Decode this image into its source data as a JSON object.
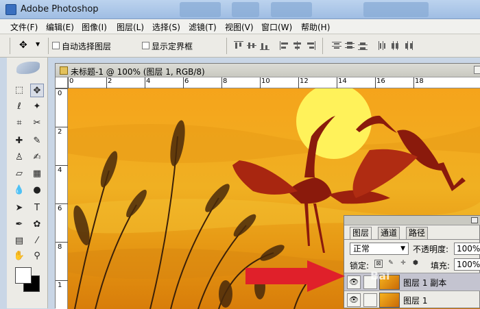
{
  "app": {
    "title": "Adobe Photoshop"
  },
  "menu": [
    "文件(F)",
    "编辑(E)",
    "图像(I)",
    "图层(L)",
    "选择(S)",
    "滤镜(T)",
    "视图(V)",
    "窗口(W)",
    "帮助(H)"
  ],
  "options": {
    "auto_select_label": "自动选择图层",
    "show_bounds_label": "显示定界框"
  },
  "document": {
    "title": "未标题-1 @ 100% (图层 1, RGB/8)",
    "ruler_h_labels": [
      "0",
      "2",
      "4",
      "6",
      "8",
      "10",
      "12",
      "14",
      "16",
      "18"
    ],
    "ruler_v_labels": [
      "0",
      "2",
      "4",
      "6",
      "8",
      "1"
    ]
  },
  "layers_panel": {
    "tabs": [
      "图层",
      "通道",
      "路径"
    ],
    "blend_mode": "正常",
    "opacity_label": "不透明度:",
    "opacity_value": "100%",
    "lock_label": "锁定:",
    "fill_label": "填充:",
    "fill_value": "100%",
    "layers": [
      {
        "name": "图层 1 副本",
        "selected": true
      },
      {
        "name": "图层 1",
        "selected": false
      }
    ]
  },
  "colors": {
    "arrow": "#e0202a",
    "sky_top": "#f5a41b",
    "sun": "#fff25a"
  },
  "watermark": "Bai"
}
